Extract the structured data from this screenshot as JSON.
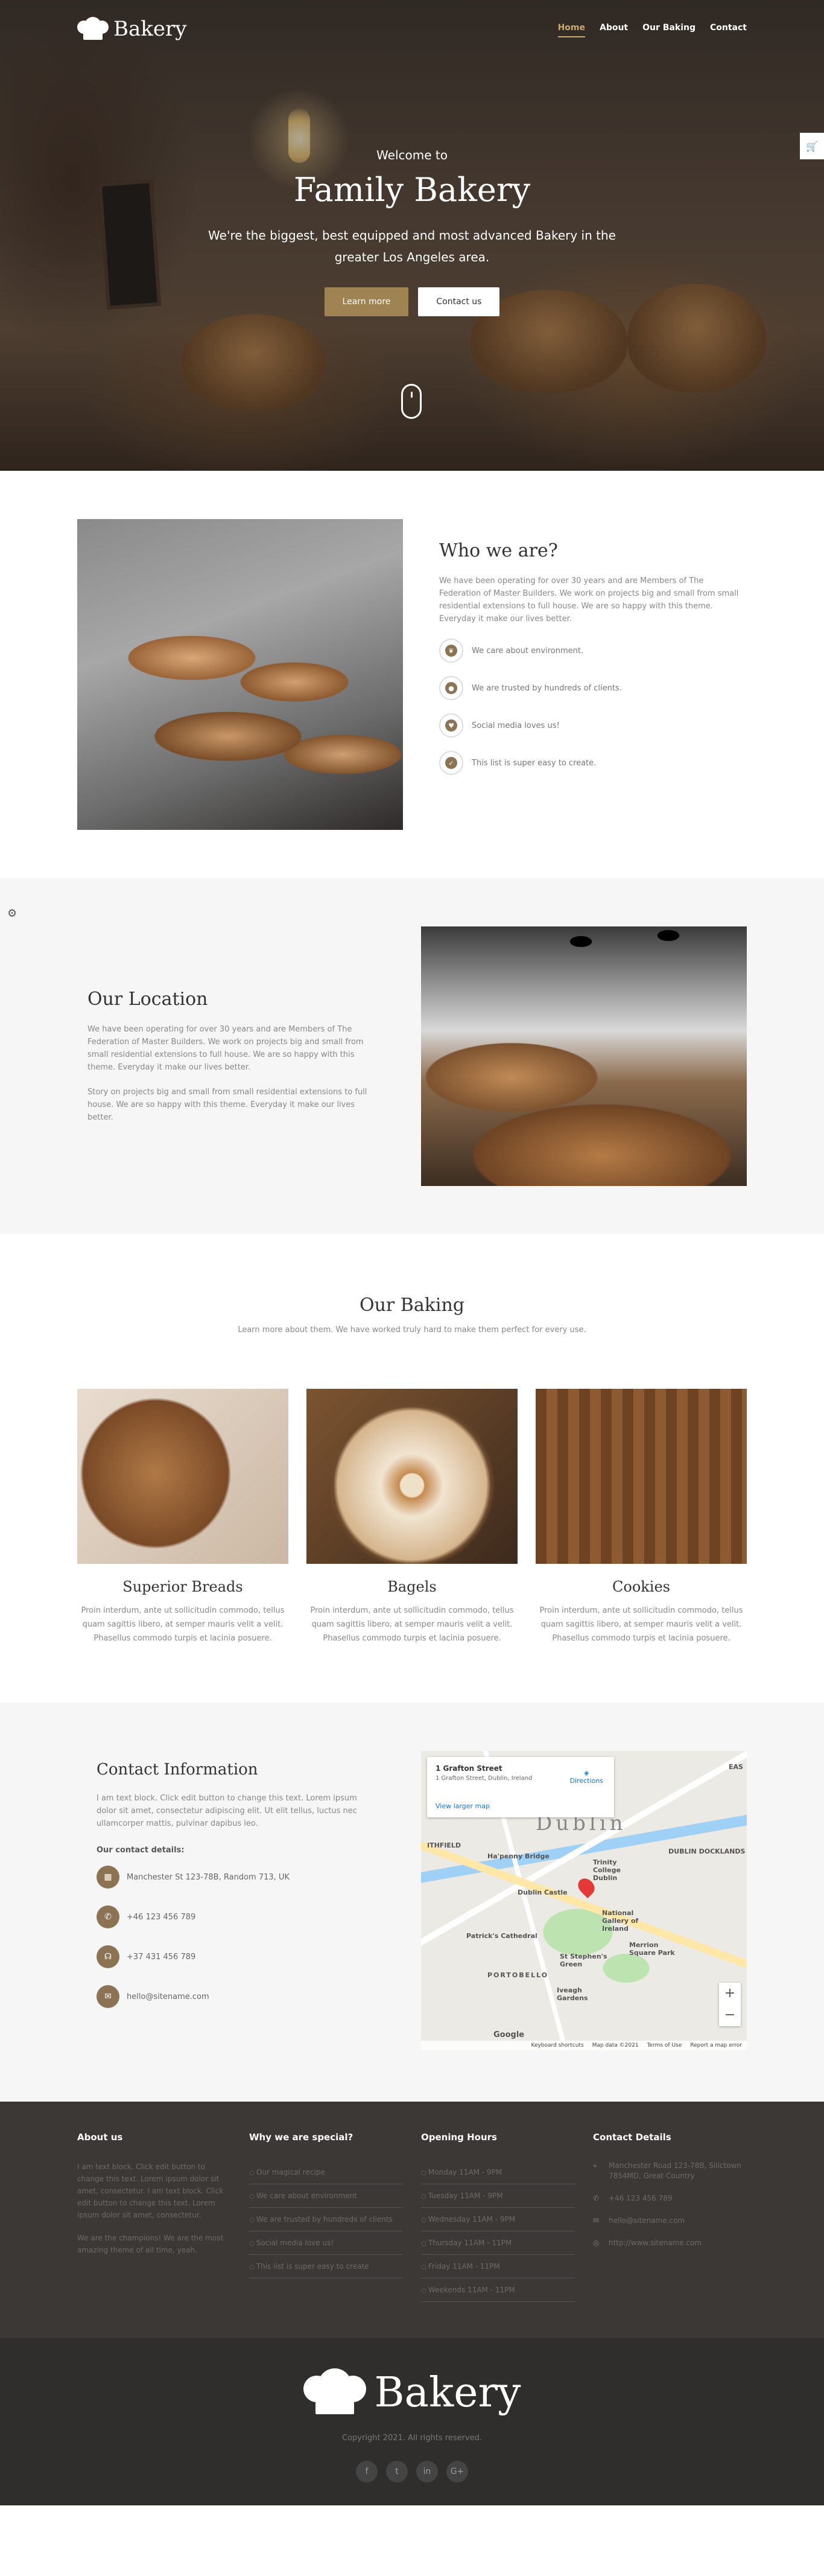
{
  "brand": {
    "name": "Bakery"
  },
  "nav": {
    "items": [
      "Home",
      "About",
      "Our Baking",
      "Contact"
    ],
    "active": "Home"
  },
  "hero": {
    "pre_title": "Welcome to",
    "title": "Family Bakery",
    "text": "We're the biggest, best equipped and most advanced Bakery in the greater Los Angeles area.",
    "btn_primary": "Learn more",
    "btn_secondary": "Contact us"
  },
  "who": {
    "title": "Who we are?",
    "text": "We have been operating for over 30 years and are Members of The Federation of Master Builders. We work on projects big and small from small residential extensions to full house. We are so happy with this theme. Everyday it make our lives better.",
    "features": [
      {
        "icon": "leaf-icon",
        "text": "We care about environment."
      },
      {
        "icon": "users-icon",
        "text": "We are trusted by hundreds of clients."
      },
      {
        "icon": "heart-icon",
        "text": "Social media loves us!"
      },
      {
        "icon": "check-icon",
        "text": "This list is super easy to create."
      }
    ]
  },
  "location": {
    "title": "Our Location",
    "p1": "We have been operating for over 30 years and are Members of The Federation of Master Builders. We work on projects big and small from small residential extensions to full house. We are so happy with this theme. Everyday it make our lives better.",
    "p2": "Story on projects big and small from small residential extensions to full house. We are so happy with this theme. Everyday it make our lives better."
  },
  "baking": {
    "title": "Our Baking",
    "subtitle": "Learn more about them. We have worked truly hard to make them perfect for every use.",
    "items": [
      {
        "title": "Superior Breads",
        "text": "Proin interdum, ante ut sollicitudin commodo, tellus quam sagittis libero, at semper mauris velit a velit. Phasellus commodo turpis et lacinia posuere."
      },
      {
        "title": "Bagels",
        "text": "Proin interdum, ante ut sollicitudin commodo, tellus quam sagittis libero, at semper mauris velit a velit. Phasellus commodo turpis et lacinia posuere."
      },
      {
        "title": "Cookies",
        "text": "Proin interdum, ante ut sollicitudin commodo, tellus quam sagittis libero, at semper mauris velit a velit. Phasellus commodo turpis et lacinia posuere."
      }
    ]
  },
  "contact": {
    "title": "Contact Information",
    "text": "I am text block. Click edit button to change this text. Lorem ipsum dolor sit amet, consectetur adipiscing elit. Ut elit tellus, luctus nec ullamcorper mattis, pulvinar dapibus leo.",
    "details_label": "Our contact details:",
    "rows": [
      {
        "icon": "map-icon",
        "text": "Manchester St 123-78B, Random 713, UK"
      },
      {
        "icon": "phone-icon",
        "text": "+46 123 456 789"
      },
      {
        "icon": "headset-icon",
        "text": "+37 431 456 789"
      },
      {
        "icon": "mail-icon",
        "text": "hello@sitename.com"
      }
    ]
  },
  "map": {
    "place": "1 Grafton Street",
    "address": "1 Grafton Street, Dublin, Ireland",
    "directions": "Directions",
    "larger": "View larger map",
    "city": "Dublin",
    "labels": [
      "ITHFIELD",
      "Ha'penny Bridge",
      "Trinity College Dublin",
      "Dublin Castle",
      "National Gallery of Ireland",
      "Merrion Square Park",
      "St Stephen's Green",
      "PORTOBELLO",
      "Iveagh Gardens",
      "Patrick's Cathedral",
      "DUBLIN DOCKLANDS",
      "EAS"
    ],
    "footer": [
      "Keyboard shortcuts",
      "Map data ©2021",
      "Terms of Use",
      "Report a map error"
    ],
    "google": "Google",
    "zoom_in": "+",
    "zoom_out": "−"
  },
  "footer": {
    "about": {
      "title": "About us",
      "p1": "I am text block. Click edit button to change this text. Lorem ipsum dolor sit amet, consectetur. I am text block. Click edit button to change this text. Lorem ipsum dolor sit amet, consectetur.",
      "p2": "We are the champions! We are the most amazing theme of all time, yeah."
    },
    "special": {
      "title": "Why we are special?",
      "items": [
        "Our magical recipe",
        "We care about environment",
        "We are trusted by hundreds of clients",
        "Social media love us!",
        "This list is super easy to create"
      ]
    },
    "hours": {
      "title": "Opening Hours",
      "items": [
        "Monday 11AM - 9PM",
        "Tuesday 11AM - 9PM",
        "Wednesday 11AM - 9PM",
        "Thursday 11AM - 11PM",
        "Friday 11AM - 11PM",
        "Weekends 11AM - 11PM"
      ]
    },
    "details": {
      "title": "Contact Details",
      "address": "Manchester Road 123-78B, Silictown 7854MD, Great Country",
      "phone": "+46 123 456 789",
      "email": "hello@sitename.com",
      "web": "http://www.sitename.com"
    }
  },
  "bottom": {
    "copyright": "Copyright 2021. All rights reserved.",
    "social": [
      "f",
      "t",
      "in",
      "G+"
    ]
  }
}
